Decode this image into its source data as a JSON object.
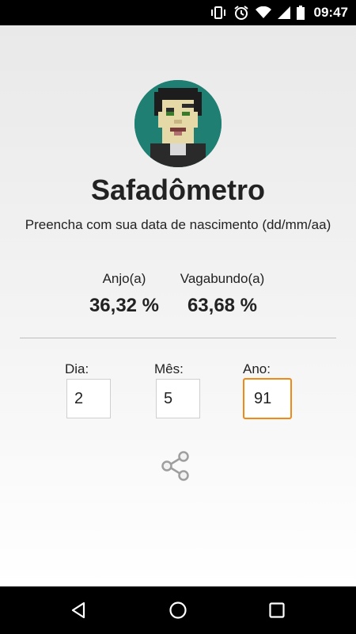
{
  "status_bar": {
    "time": "09:47",
    "icons": [
      "vibrate-icon",
      "alarm-icon",
      "wifi-icon",
      "signal-icon",
      "battery-icon"
    ]
  },
  "app": {
    "avatar_icon": "pixel-face-avatar",
    "title": "Safadômetro",
    "subtitle": "Preencha com sua data de nascimento (dd/mm/aa)"
  },
  "stats": {
    "angel": {
      "label": "Anjo(a)",
      "value": "36,32 %"
    },
    "vagabond": {
      "label": "Vagabundo(a)",
      "value": "63,68 %"
    }
  },
  "form": {
    "day": {
      "label": "Dia:",
      "value": "2"
    },
    "month": {
      "label": "Mês:",
      "value": "5"
    },
    "year": {
      "label": "Ano:",
      "value": "91"
    }
  },
  "share": {
    "icon": "share-icon"
  },
  "nav": {
    "icons": [
      "back-icon",
      "home-icon",
      "recents-icon"
    ]
  },
  "colors": {
    "focus_border": "#ef8a17",
    "avatar_bg": "#1f7f73"
  }
}
